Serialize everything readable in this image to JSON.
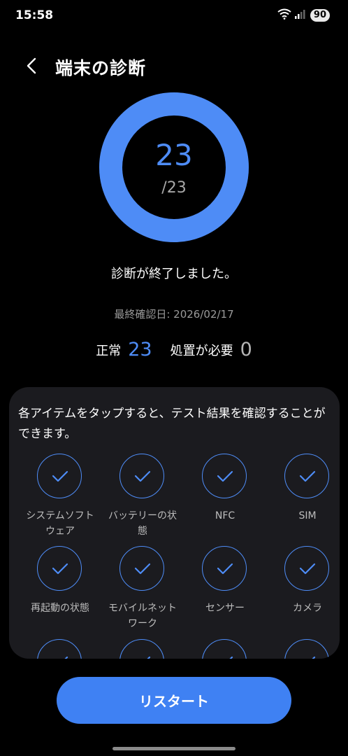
{
  "status_bar": {
    "time": "15:58",
    "battery": "90"
  },
  "header": {
    "title": "端末の診断"
  },
  "progress": {
    "count": "23",
    "total": "/23",
    "fraction": 1.0,
    "color": "#4e8cf6"
  },
  "result": {
    "message": "診断が終了しました。",
    "last_check": "最終確認日: 2026/02/17",
    "normal_label": "正常",
    "normal_count": "23",
    "action_label": "処置が必要",
    "action_count": "0"
  },
  "panel": {
    "hint": "各アイテムをタップすると、テスト結果を確認することができます。",
    "items": [
      {
        "label": "システムソフトウェア"
      },
      {
        "label": "バッテリーの状態"
      },
      {
        "label": "NFC"
      },
      {
        "label": "SIM"
      },
      {
        "label": "再起動の状態"
      },
      {
        "label": "モバイルネットワーク"
      },
      {
        "label": "センサー"
      },
      {
        "label": "カメラ"
      },
      {
        "label": ""
      },
      {
        "label": ""
      },
      {
        "label": ""
      },
      {
        "label": ""
      }
    ]
  },
  "footer": {
    "restart_label": "リスタート"
  }
}
